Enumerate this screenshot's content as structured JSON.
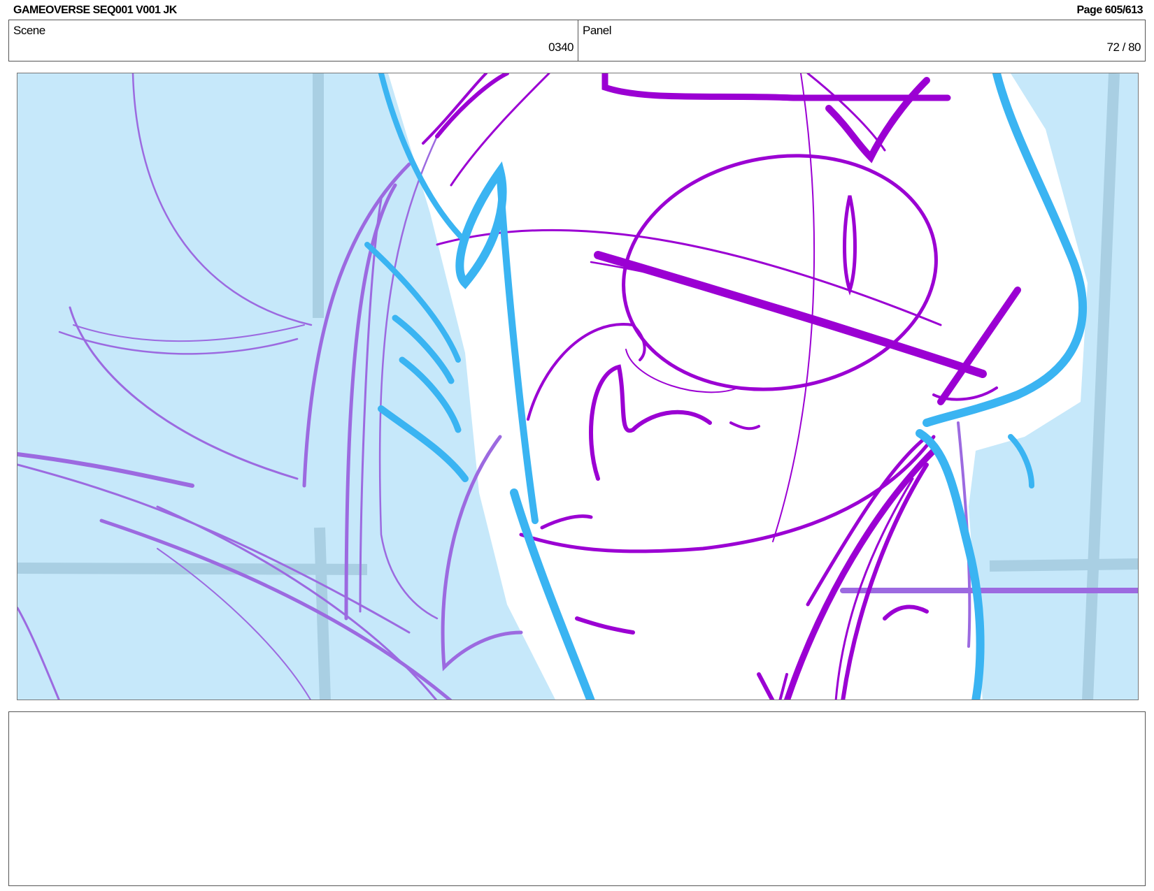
{
  "header": {
    "title": "GAMEOVERSE SEQ001 V001 JK",
    "page": "Page 605/613"
  },
  "info": {
    "scene_label": "Scene",
    "scene_value": "0340",
    "panel_label": "Panel",
    "panel_value": "72 / 80"
  },
  "sketch": {
    "colors": {
      "background": "#c6e8fa",
      "grid": "#a9cfe3",
      "skin": "#ffffff",
      "purple": "#9b00d3",
      "lavender": "#9c6ae0",
      "cyan": "#3ab4f2"
    }
  },
  "notes": {
    "text": ""
  }
}
